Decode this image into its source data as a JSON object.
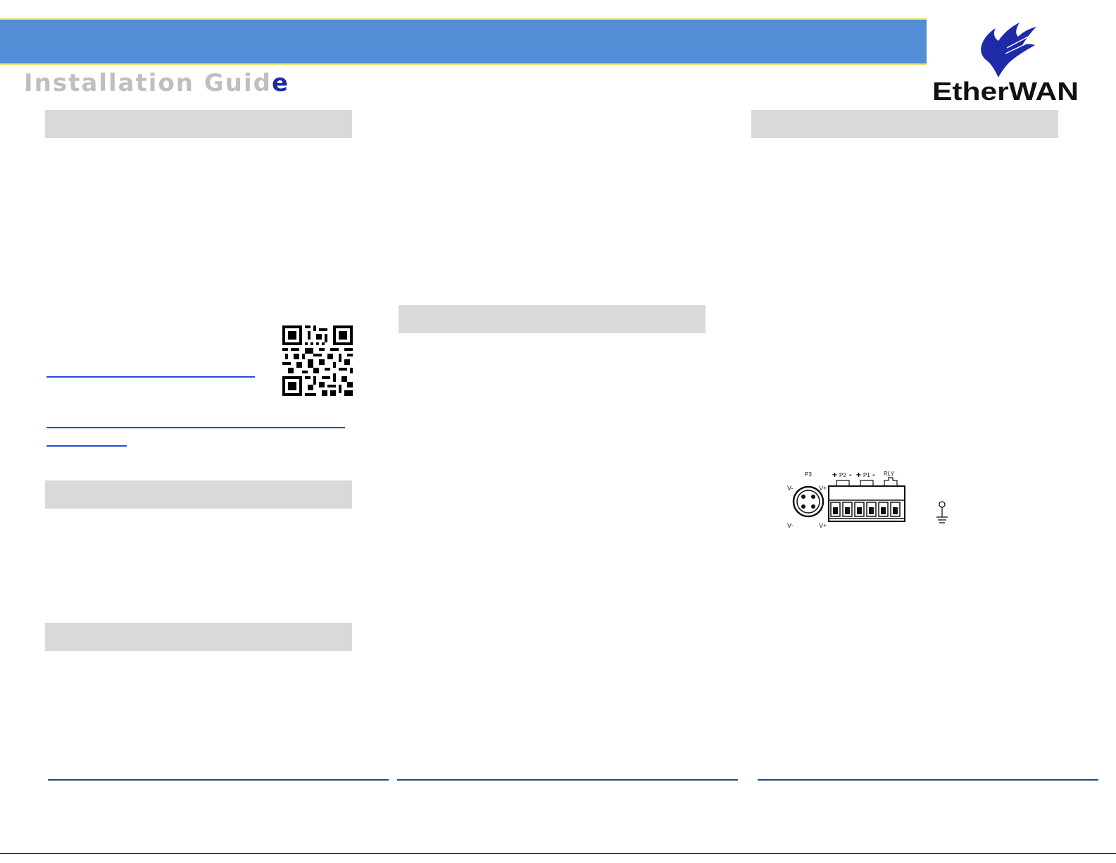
{
  "header": {
    "title_faded": "Installation Guid",
    "title_accent": "e"
  },
  "logo": {
    "brand_name": "EtherWAN"
  },
  "diagram": {
    "labels": {
      "p3": "P3",
      "p2": "P2",
      "p1": "P1",
      "rly": "RLY",
      "v_minus": "V-",
      "v_plus": "V+",
      "plus": "+",
      "minus": "-"
    }
  },
  "colors": {
    "header_band": "#538dd5",
    "header_border": "#e6e15a",
    "section_bar": "#d9d9d9",
    "link": "#1f4fd6",
    "footer_rule": "#1f4e79",
    "logo_blue": "#1f2aa8"
  }
}
